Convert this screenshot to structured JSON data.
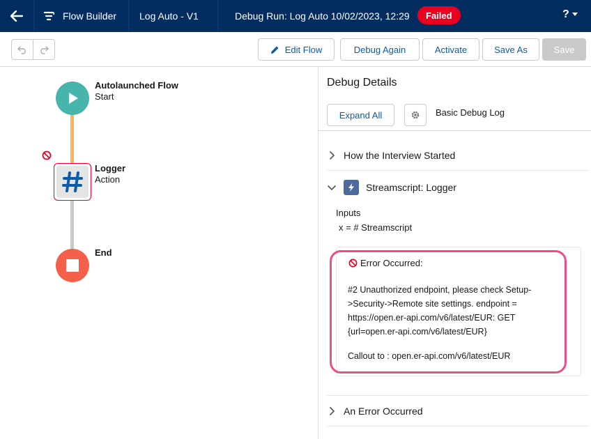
{
  "header": {
    "app_name": "Flow Builder",
    "flow_name": "Log Auto - V1",
    "run_title": "Debug Run: Log Auto 10/02/2023, 12:29",
    "status_badge": "Failed",
    "help_label": "?"
  },
  "toolbar": {
    "edit_flow": "Edit Flow",
    "debug_again": "Debug Again",
    "activate": "Activate",
    "save_as": "Save As",
    "save": "Save"
  },
  "canvas": {
    "start": {
      "title": "Autolaunched Flow",
      "subtitle": "Start"
    },
    "action": {
      "title": "Logger",
      "subtitle": "Action"
    },
    "end": {
      "title": "End"
    }
  },
  "debug_panel": {
    "title": "Debug Details",
    "expand_all": "Expand All",
    "log_level": "Basic Debug Log",
    "sections": {
      "started": "How the Interview Started",
      "logger": "Streamscript: Logger",
      "error": "An Error Occurred"
    },
    "inputs_label": "Inputs",
    "inputs_value": "x = # Streamscript",
    "error_title": "Error Occurred:",
    "error_message": "#2 Unauthorized endpoint, please check Setup->Security->Remote site settings. endpoint = https://open.er-api.com/v6/latest/EUR: GET {url=open.er-api.com/v6/latest/EUR}",
    "callout": "Callout to : open.er-api.com/v6/latest/EUR"
  },
  "colors": {
    "header_bg": "#032d60",
    "failed": "#ea001e",
    "start_node": "#48b5ad",
    "end_node": "#f4604a",
    "connector_top": "#f9b55e",
    "connector_bottom": "#c9c9c9",
    "highlight": "#ea4f8a"
  }
}
